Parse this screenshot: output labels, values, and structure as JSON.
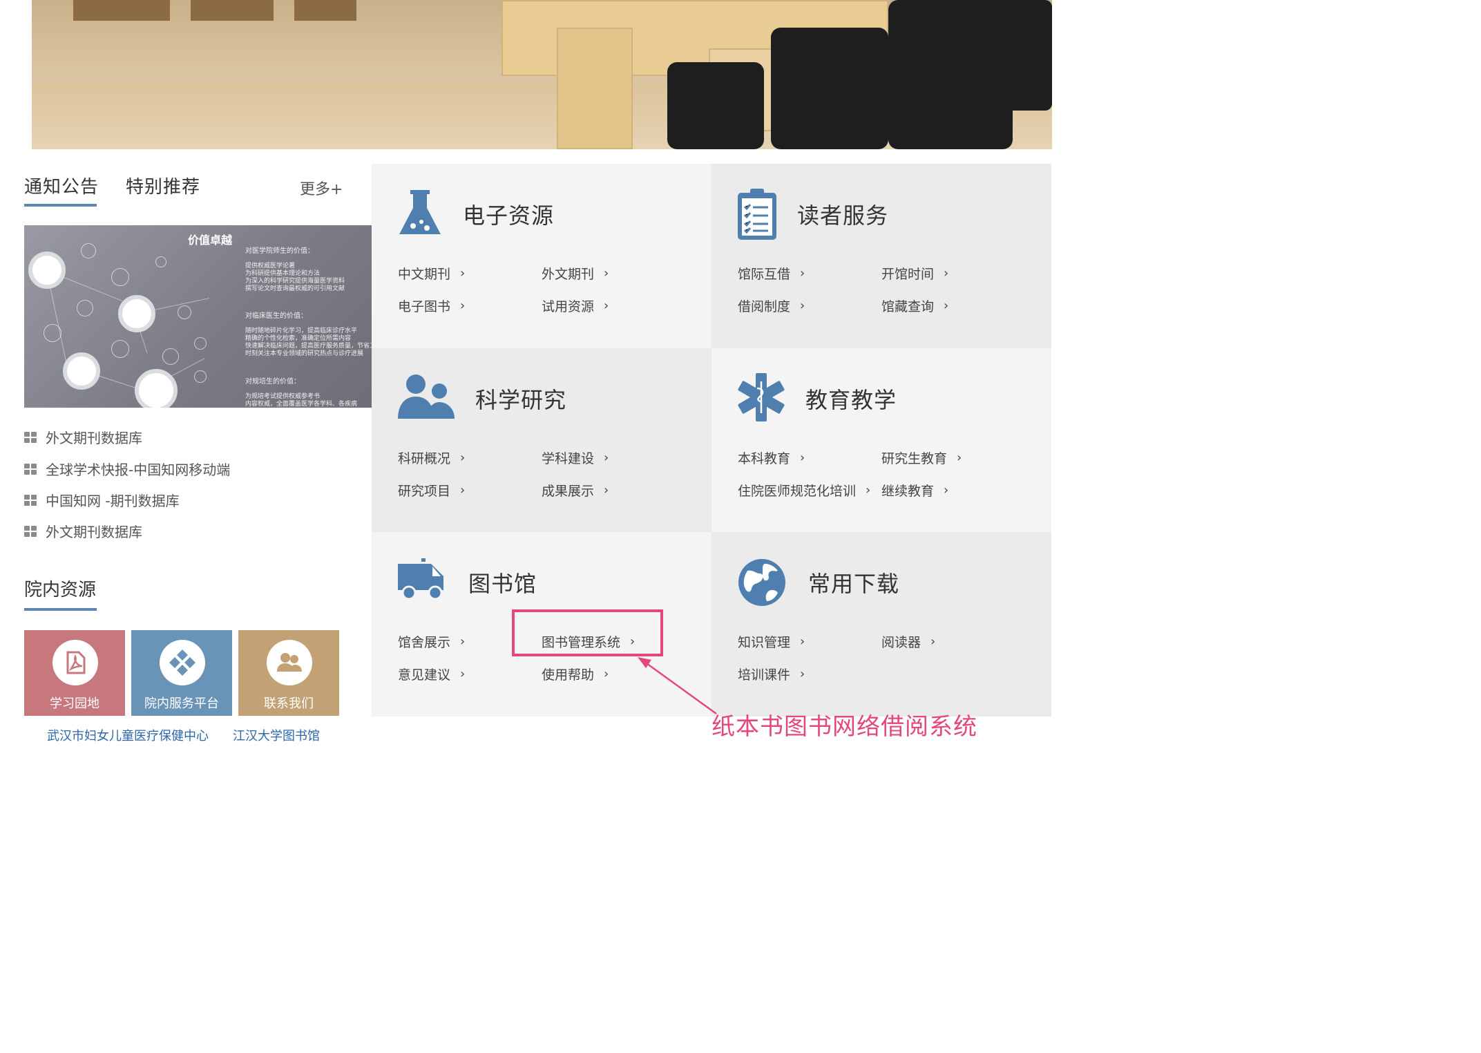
{
  "tabs": {
    "notice": "通知公告",
    "recommend": "特别推荐",
    "more": "更多+"
  },
  "notice_image": {
    "title": "价值卓越",
    "sections": [
      {
        "heading": "对医学院师生的价值：",
        "lines": [
          "提供权威医学论著",
          "为科研提供基本理论和方法",
          "为深入的科学研究提供海量医学资料",
          "撰写论文时查询最权威的可引用文献"
        ]
      },
      {
        "heading": "对临床医生的价值：",
        "lines": [
          "随时随地碎片化学习，提高临床诊疗水平",
          "精确的个性化检索，准确定位所需内容",
          "快速解决临床问题，提高医疗服务质量，节省工作时间",
          "时刻关注本专业领域的研究热点与诊疗进展"
        ]
      },
      {
        "heading": "对规培生的价值：",
        "lines": [
          "为规培考试提供权威参考书",
          "内容权威，全面覆盖医学各学科、各疾病"
        ]
      }
    ]
  },
  "news": [
    "外文期刊数据库",
    "全球学术快报-中国知网移动端",
    "中国知网 -期刊数据库",
    "外文期刊数据库"
  ],
  "resources": {
    "title": "院内资源",
    "tiles": [
      {
        "label": "学习园地",
        "color": "#c7787c",
        "icon": "pdf-icon"
      },
      {
        "label": "院内服务平台",
        "color": "#6a93b8",
        "icon": "puzzle-icon"
      },
      {
        "label": "联系我们",
        "color": "#c2a175",
        "icon": "people-icon"
      }
    ],
    "links": [
      "武汉市妇女儿童医疗保健中心",
      "江汉大学图书馆"
    ]
  },
  "panels": [
    {
      "title": "电子资源",
      "icon": "flask-icon",
      "links": [
        "中文期刊",
        "外文期刊",
        "电子图书",
        "试用资源"
      ]
    },
    {
      "title": "读者服务",
      "icon": "clipboard-icon",
      "links": [
        "馆际互借",
        "开馆时间",
        "借阅制度",
        "馆藏查询"
      ]
    },
    {
      "title": "科学研究",
      "icon": "people-icon",
      "links": [
        "科研概况",
        "学科建设",
        "研究项目",
        "成果展示"
      ]
    },
    {
      "title": "教育教学",
      "icon": "medical-star-icon",
      "links": [
        "本科教育",
        "研究生教育",
        "住院医师规范化培训",
        "继续教育"
      ]
    },
    {
      "title": "图书馆",
      "icon": "ambulance-icon",
      "links": [
        "馆舍展示",
        "图书管理系统",
        "意见建议",
        "使用帮助"
      ]
    },
    {
      "title": "常用下载",
      "icon": "globe-icon",
      "links": [
        "知识管理",
        "阅读器",
        "培训课件"
      ]
    }
  ],
  "chevron": "›",
  "annotation": {
    "text": "纸本书图书网络借阅系统",
    "color": "#e4477d"
  },
  "colors": {
    "panel_light": "#f4f4f4",
    "panel_dark": "#ebebeb",
    "icon_blue": "#4f7fae",
    "accent_blue": "#5b87b0"
  }
}
